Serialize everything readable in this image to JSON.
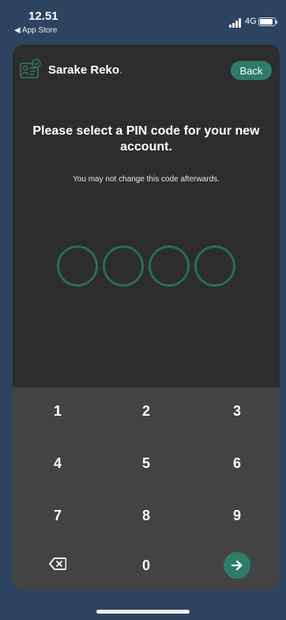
{
  "status_bar": {
    "time": "12.51",
    "back_to_app": "◀ App Store",
    "network": "4G"
  },
  "header": {
    "brand_name": "Sarake Reko",
    "brand_dot": ".",
    "back_label": "Back"
  },
  "main": {
    "title": "Please select a PIN code for your new account.",
    "subtitle": "You may not change this code afterwards.",
    "pin_length": 4,
    "pin_entered": 0
  },
  "keypad": {
    "keys": [
      "1",
      "2",
      "3",
      "4",
      "5",
      "6",
      "7",
      "8",
      "9",
      "0"
    ],
    "backspace_icon": "backspace-icon",
    "submit_icon": "arrow-right-icon"
  },
  "colors": {
    "accent": "#2e7c68",
    "background": "#2c4460",
    "card": "#2d2d2d",
    "keypad": "#434343",
    "brand_dot": "#e04a3a"
  }
}
